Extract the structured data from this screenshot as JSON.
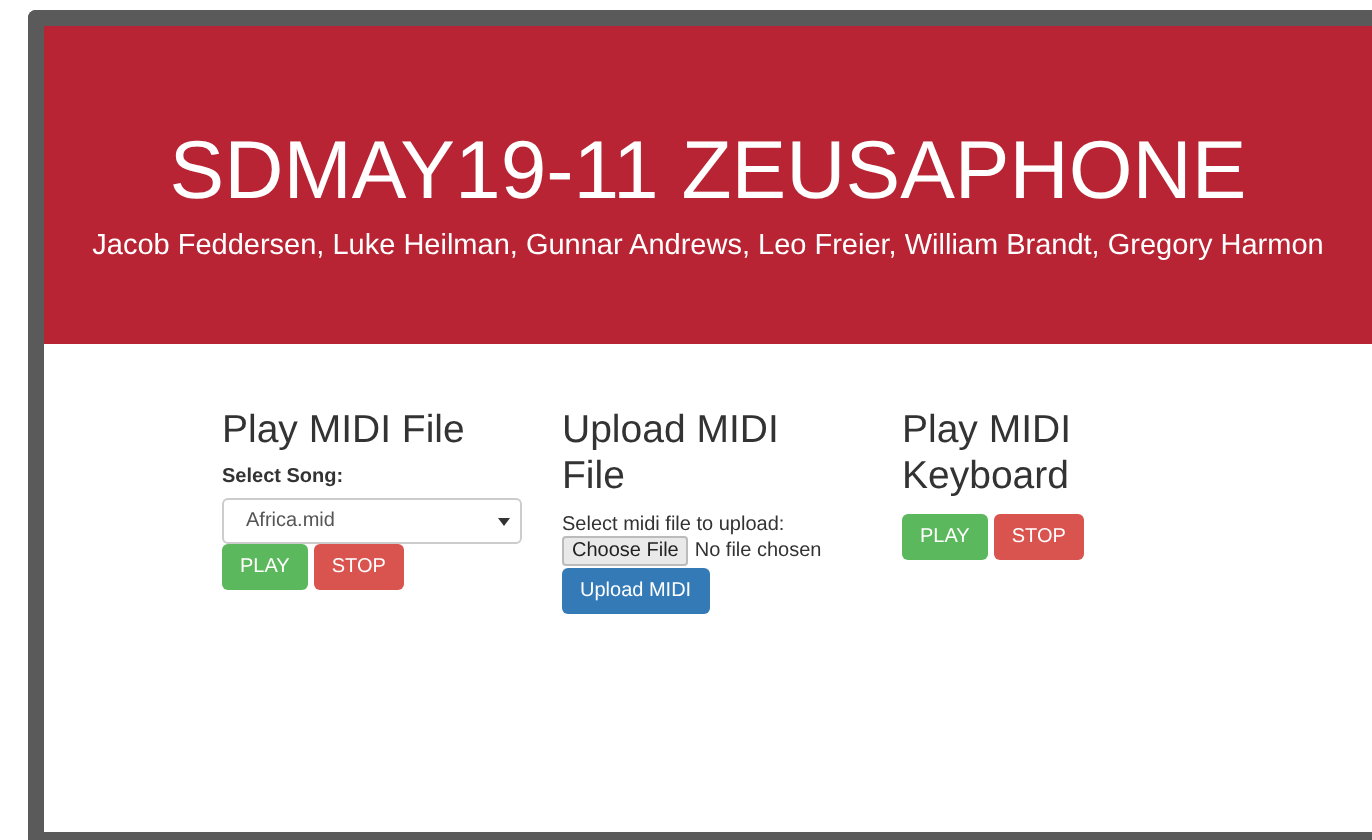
{
  "header": {
    "title": "SDMAY19-11 ZEUSAPHONE",
    "subtitle": "Jacob Feddersen, Luke Heilman, Gunnar Andrews, Leo Freier, William Brandt, Gregory Harmon"
  },
  "panels": [
    {
      "kind": "player",
      "heading": "Play MIDI File",
      "label": "Select Song:",
      "select_value": "Africa.mid",
      "play": "PLAY",
      "stop": "STOP"
    },
    {
      "kind": "upload",
      "heading": "Upload MIDI File",
      "label": "Select midi file to upload:",
      "choose": "Choose File",
      "file_status": "No file chosen",
      "upload": "Upload MIDI"
    },
    {
      "kind": "keyboard",
      "heading": "Play MIDI Keyboard",
      "play": "PLAY",
      "stop": "STOP"
    }
  ]
}
